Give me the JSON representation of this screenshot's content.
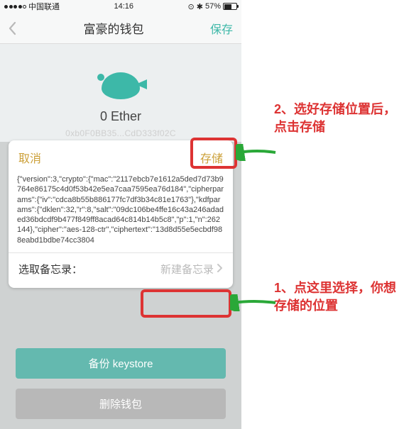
{
  "status": {
    "carrier": "中国联通",
    "time": "14:16",
    "battery_pct": "57%"
  },
  "nav": {
    "title": "富豪的钱包",
    "save": "保存"
  },
  "wallet": {
    "balance": "0 Ether",
    "address": "0xb0F0BB35...CdD333f02C"
  },
  "sheet": {
    "cancel": "取消",
    "store": "存储",
    "json_text": "{\"version\":3,\"crypto\":{\"mac\":\"2117ebcb7e1612a5ded7d73b9764e86175c4d0f53b42e5ea7caa7595ea76d184\",\"cipherparams\":{\"iv\":\"cdca8b55b886177fc7df3b34c81e1763\"},\"kdfparams\":{\"dklen\":32,\"r\":8,\"salt\":\"09dc106be4ffe16c43a246adaded36bdcdf9b477f849ff8acad64c814b14b5c8\",\"p\":1,\"n\":262144},\"cipher\":\"aes-128-ctr\",\"ciphertext\":\"13d8d55e5ecbdf988eabd1bdbe74cc3804",
    "memo_label": "选取备忘录：",
    "memo_placeholder": "新建备忘录"
  },
  "buttons": {
    "backup": "备份 keystore",
    "delete": "删除钱包"
  },
  "notes": {
    "n1": "1、点这里选择，你想存储的位置",
    "n2": "2、选好存储位置后，点击存储"
  }
}
